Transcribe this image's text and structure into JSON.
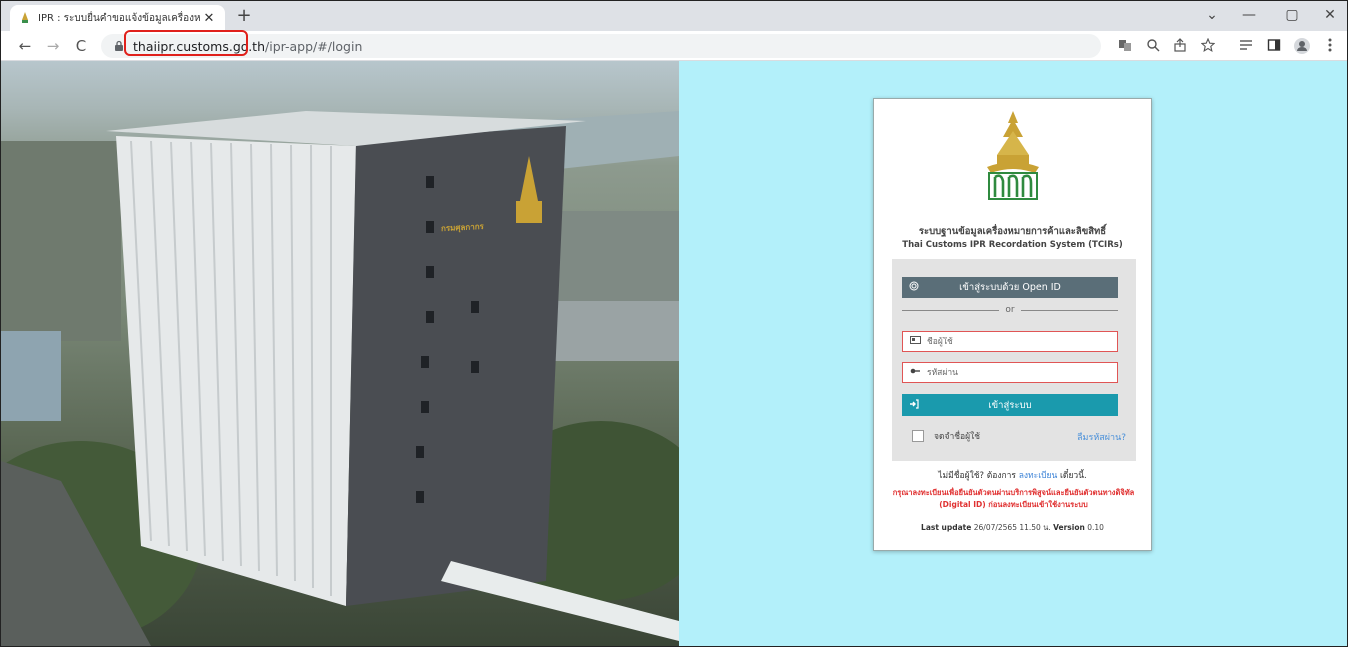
{
  "browser": {
    "tab_title": "IPR : ระบบยื่นคำขอแจ้งข้อมูลเครื่องหมา",
    "tab_close": "✕",
    "new_tab": "+",
    "url_host": "thaiipr.customs.go.th",
    "url_path": "/ipr-app/#/login",
    "nav": {
      "back": "←",
      "forward": "→",
      "reload": "C"
    },
    "window": {
      "dropdown": "⌄",
      "minimize": "—",
      "maximize": "▢",
      "close": "✕"
    }
  },
  "building_sign": "กรมศุลกากร",
  "login": {
    "system_name_th": "ระบบฐานข้อมูลเครื่องหมายการค้าและลิขสิทธิ์",
    "system_name_en": "Thai Customs IPR Recordation System (TCIRs)",
    "openid_label": "เข้าสู่ระบบด้วย Open ID",
    "or_text": "or",
    "username_placeholder": "ชื่อผู้ใช้",
    "password_placeholder": "รหัสผ่าน",
    "login_label": "เข้าสู่ระบบ",
    "remember_label": "จดจำชื่อผู้ใช้",
    "forgot_label": "ลืมรหัสผ่าน?",
    "no_account_prefix": "ไม่มีชื่อผู้ใช้? ต้องการ",
    "register_link": "ลงทะเบียน",
    "no_account_suffix": "เดี๋ยวนี้.",
    "warning": "กรุณาลงทะเบียนเพื่อยืนยันตัวตนผ่านบริการพิสูจน์และยืนยันตัวตนทางดิจิทัล (Digital ID) ก่อนลงทะเบียนเข้าใช้งานระบบ",
    "last_update_label": "Last update",
    "last_update_value": "26/07/2565 11.50 น.",
    "version_label": "Version",
    "version_value": "0.10"
  },
  "colors": {
    "page_bg_right": "#b3f0fa",
    "openid_btn": "#5a6e78",
    "login_btn": "#1a9aad",
    "field_border": "#e05555",
    "warning_text": "#e03030",
    "link": "#3b82d6",
    "highlight_box": "#e0201b"
  }
}
